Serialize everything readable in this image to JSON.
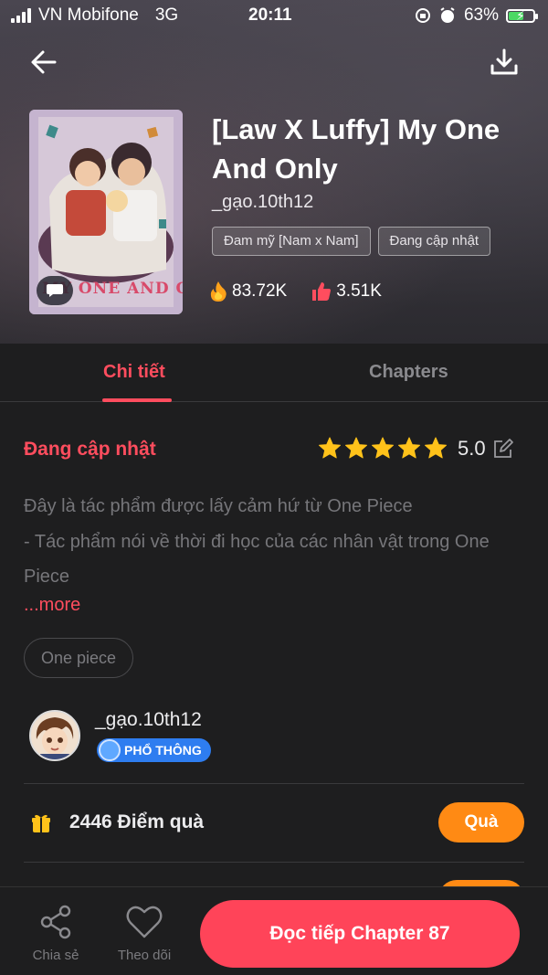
{
  "status_bar": {
    "carrier": "VN Mobifone",
    "network": "3G",
    "time": "20:11",
    "battery": "63%",
    "battery_level": 0.63
  },
  "header": {
    "back_icon": "arrow-left-icon",
    "download_icon": "download-icon"
  },
  "book": {
    "title": "[Law X Luffy] My One And Only",
    "author": "_gạo.10th12",
    "tags": [
      "Đam mỹ [Nam x Nam]",
      "Đang cập nhật"
    ],
    "views": "83.72K",
    "likes": "3.51K",
    "cover_text": "MY ONE AND ONLY"
  },
  "tabs": [
    {
      "label": "Chi tiết",
      "active": true
    },
    {
      "label": "Chapters",
      "active": false
    }
  ],
  "detail": {
    "status": "Đang cập nhật",
    "rating": "5.0",
    "stars": 5,
    "description": [
      "Đây là tác phẩm được lấy cảm hứ từ One Piece",
      "- Tác phẩm nói về thời đi học của các nhân vật trong One Piece"
    ],
    "more": "...more",
    "topic_chip": "One piece"
  },
  "author_info": {
    "name": "_gạo.10th12",
    "rank": "PHỔ THÔNG"
  },
  "gift": {
    "text": "2446 Điểm quà",
    "button": "Quà"
  },
  "bottom_bar": {
    "share_label": "Chia sẻ",
    "follow_label": "Theo dõi",
    "read_button": "Đọc tiếp Chapter 87"
  },
  "colors": {
    "accent": "#ff4d5e",
    "gift_orange": "#ff8a14",
    "background": "#1e1e1f"
  }
}
